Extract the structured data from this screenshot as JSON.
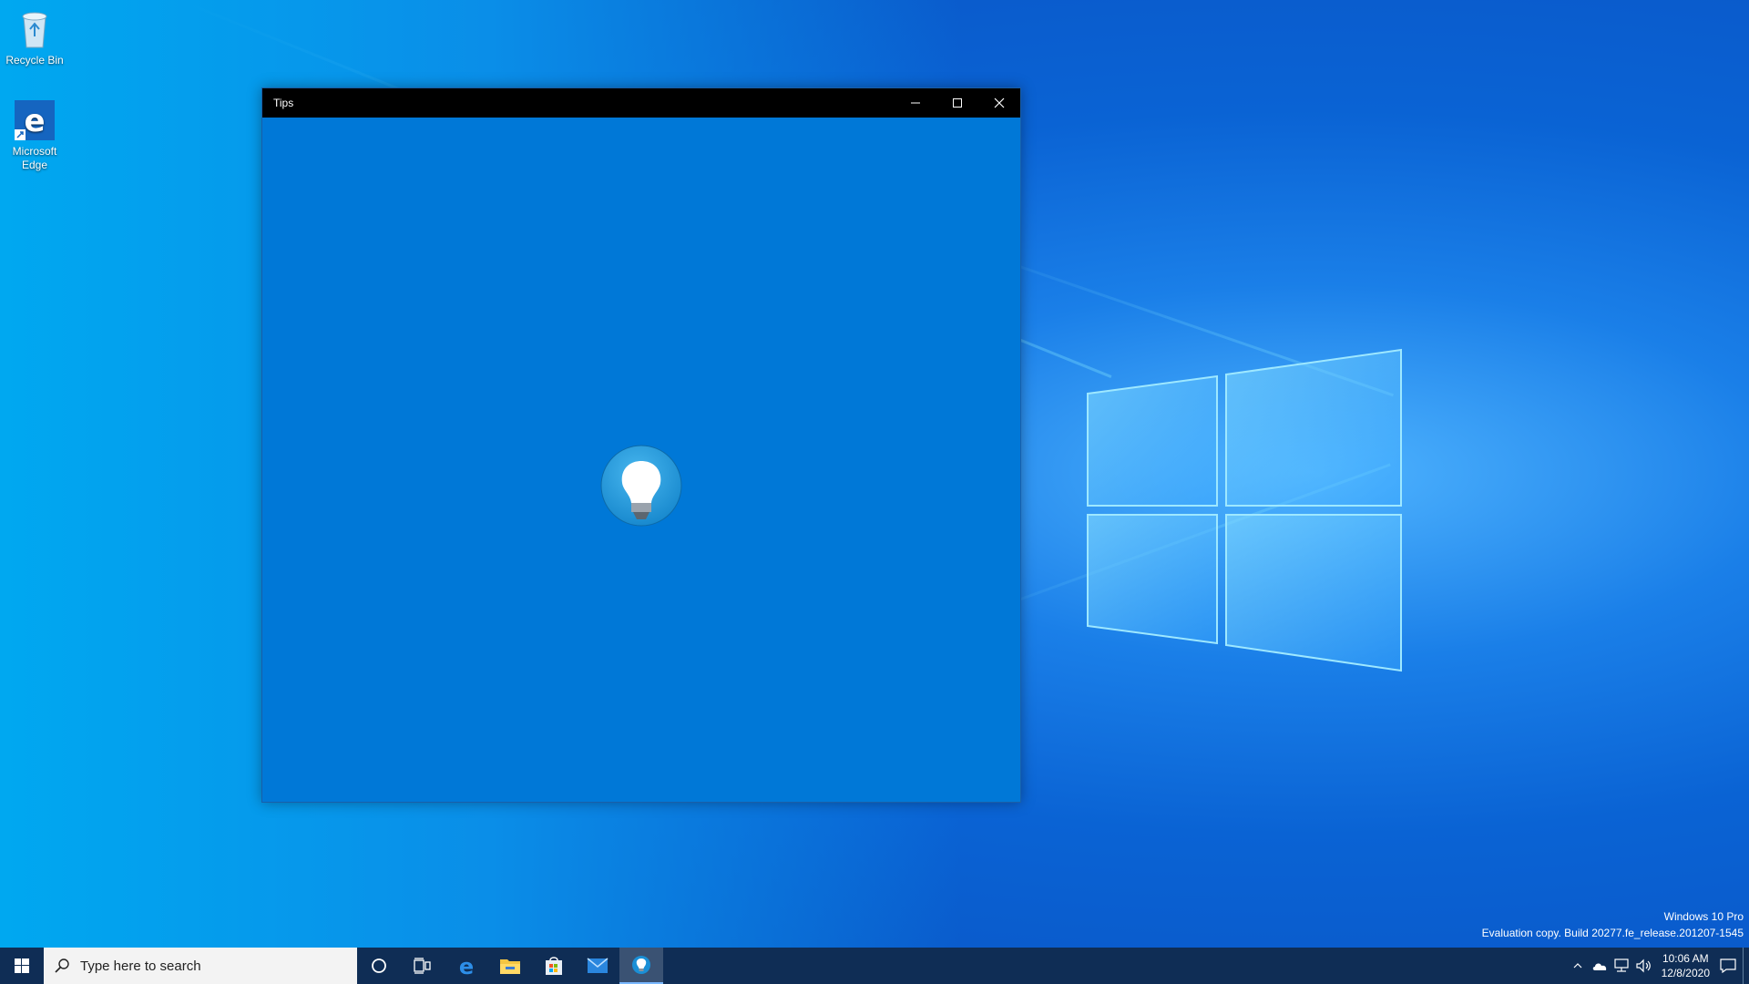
{
  "desktop": {
    "icons": [
      {
        "label": "Recycle Bin",
        "icon": "recycle-bin-icon"
      },
      {
        "label": "Microsoft Edge",
        "icon": "edge-icon"
      }
    ]
  },
  "window": {
    "title": "Tips",
    "controls": {
      "minimize": "minimize-icon",
      "maximize": "maximize-icon",
      "close": "close-icon"
    },
    "splash_icon": "lightbulb-icon",
    "background": "#0078d7"
  },
  "watermark": {
    "edition": "Windows 10 Pro",
    "build": "Evaluation copy. Build 20277.fe_release.201207-1545"
  },
  "taskbar": {
    "search_placeholder": "Type here to search",
    "pinned": [
      {
        "name": "start",
        "icon": "windows-start-icon"
      },
      {
        "name": "cortana",
        "icon": "cortana-circle-icon"
      },
      {
        "name": "task-view",
        "icon": "task-view-icon"
      },
      {
        "name": "edge",
        "icon": "edge-icon"
      },
      {
        "name": "file-explorer",
        "icon": "folder-icon"
      },
      {
        "name": "store",
        "icon": "store-icon"
      },
      {
        "name": "mail",
        "icon": "mail-icon"
      },
      {
        "name": "tips",
        "icon": "lightbulb-icon",
        "active": true
      }
    ],
    "tray": {
      "time": "10:06 AM",
      "date": "12/8/2020",
      "icons": [
        "chevron-up-icon",
        "onedrive-icon",
        "network-icon",
        "volume-icon",
        "notification-icon"
      ]
    }
  },
  "colors": {
    "accent": "#0078d7",
    "taskbar": "#0f2d55",
    "titlebar": "#000000"
  }
}
